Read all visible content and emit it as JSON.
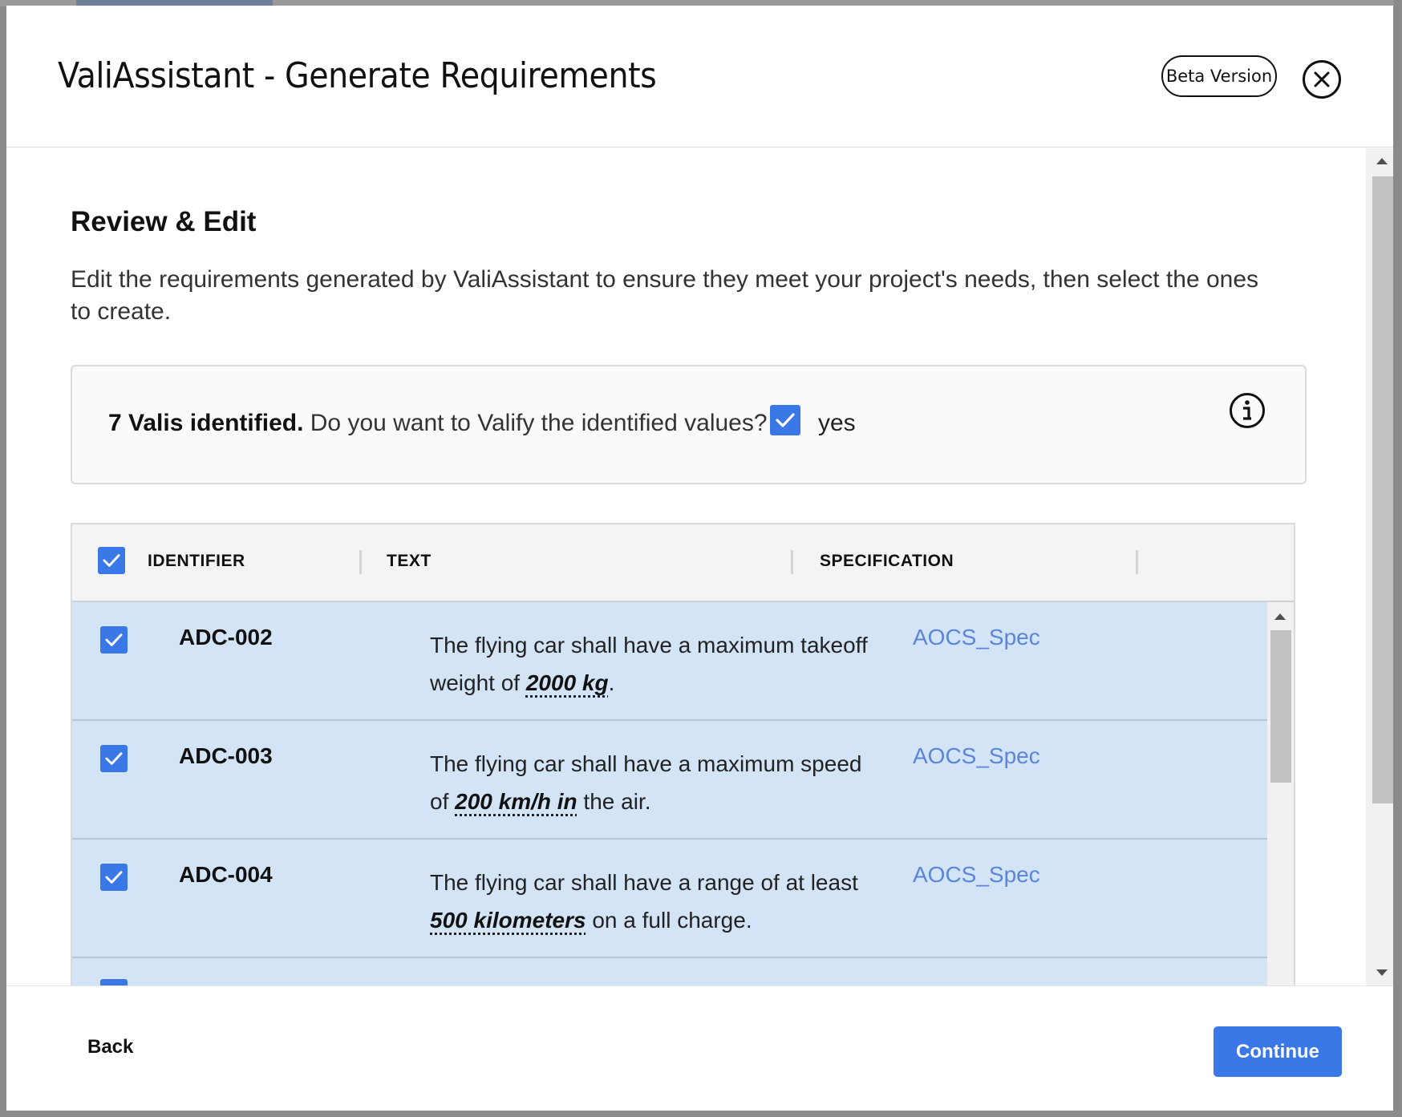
{
  "modal": {
    "title": "ValiAssistant - Generate Requirements",
    "beta_label": "Beta Version"
  },
  "review": {
    "title": "Review & Edit",
    "description": "Edit the requirements generated by ValiAssistant to ensure they meet your project's needs, then select the ones to create."
  },
  "vali": {
    "count_label": "7 Valis identified.",
    "question": " Do you want to Valify the identified values?",
    "checkbox_checked": true,
    "yes_label": "yes"
  },
  "table": {
    "columns": [
      "IDENTIFIER",
      "TEXT",
      "SPECIFICATION"
    ],
    "select_all_checked": true,
    "rows": [
      {
        "id": "ADC-002",
        "text_before": "The flying car shall have a maximum takeoff weight of ",
        "value": "2000 kg",
        "text_after": ".",
        "spec": "AOCS_Spec",
        "checked": true
      },
      {
        "id": "ADC-003",
        "text_before": "The flying car shall have a maximum speed of ",
        "value": "200 km/h in",
        "text_after": " the air.",
        "spec": "AOCS_Spec",
        "checked": true
      },
      {
        "id": "ADC-004",
        "text_before": "The flying car shall have a range of at least ",
        "value": "500 kilometers",
        "text_after": " on a full charge.",
        "spec": "AOCS_Spec",
        "checked": true
      }
    ]
  },
  "footer": {
    "back_label": "Back",
    "continue_label": "Continue"
  },
  "colors": {
    "accent": "#3b78e7",
    "row_selected": "#d3e4f7",
    "link": "#5b86d8"
  },
  "icons": {
    "close": "close-circle-icon",
    "info": "info-circle-icon",
    "check": "checkmark-icon"
  }
}
